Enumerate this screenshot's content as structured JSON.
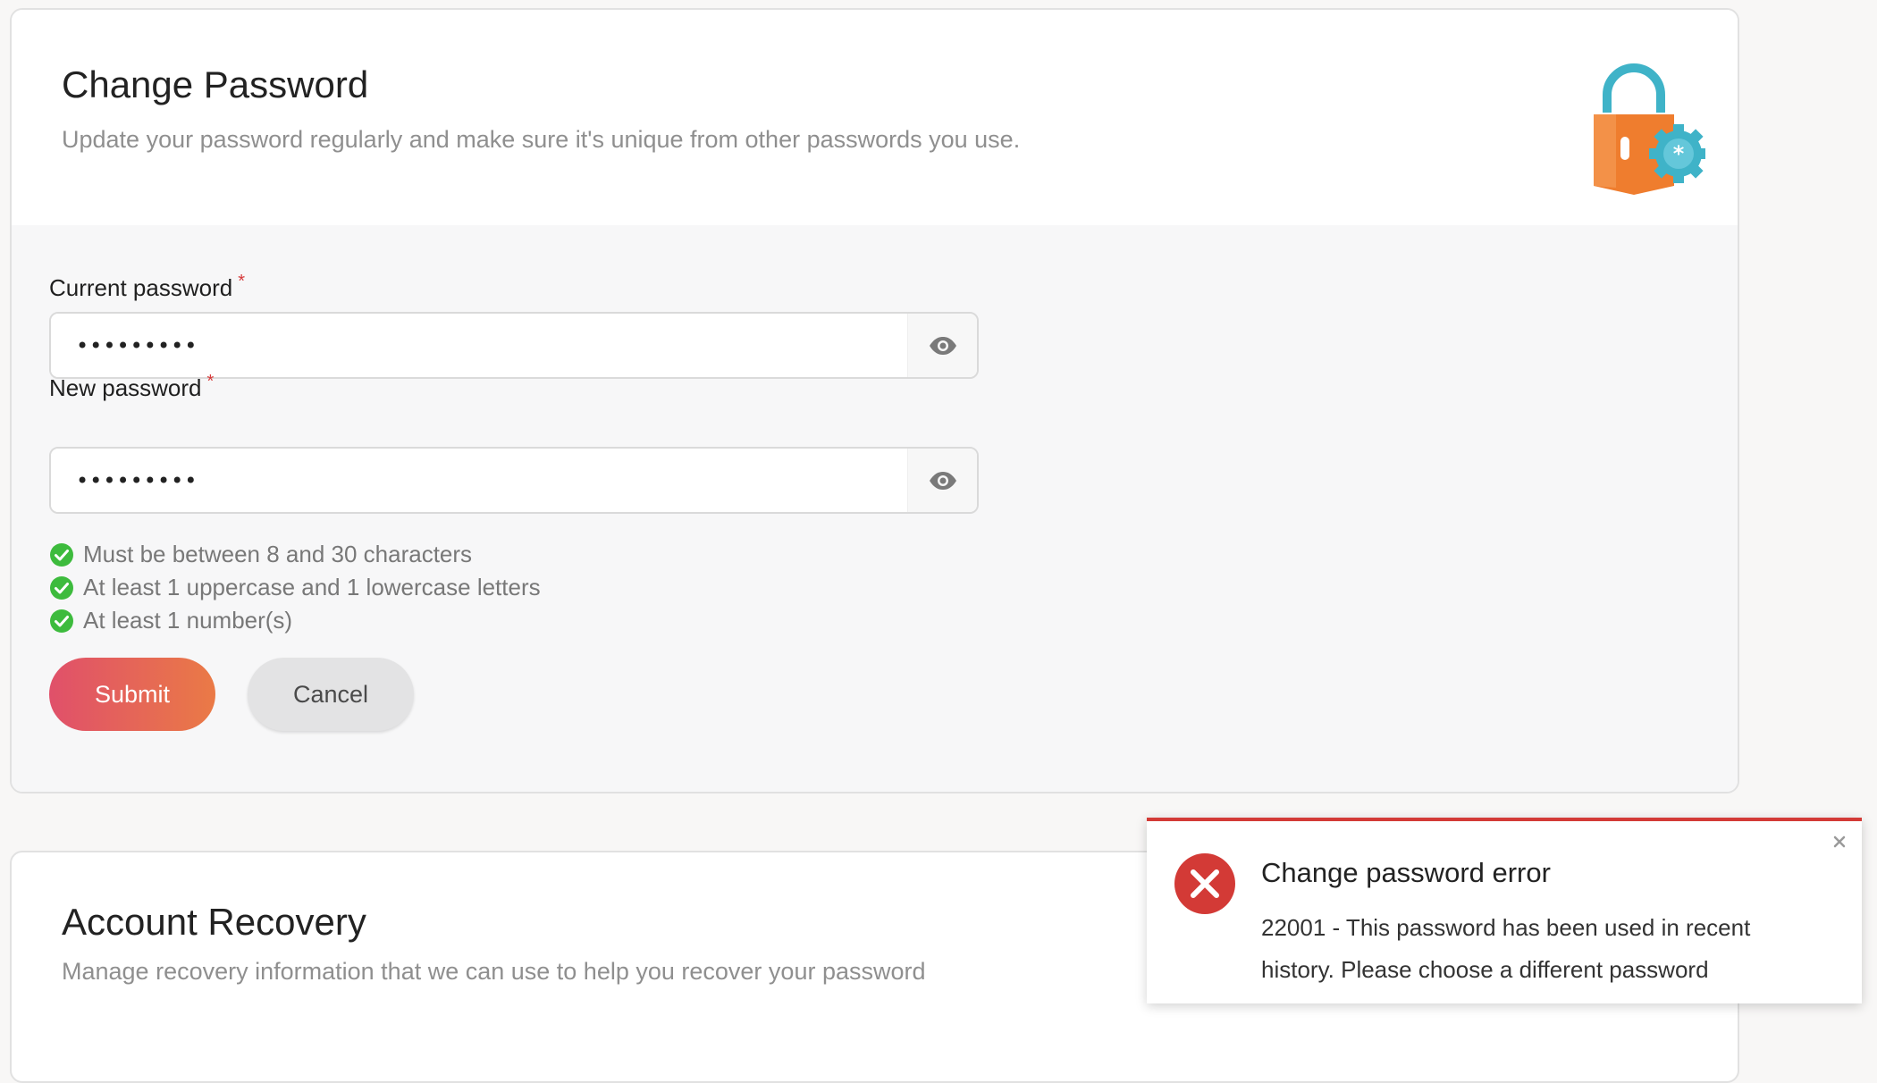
{
  "change_password": {
    "title": "Change Password",
    "description": "Update your password regularly and make sure it's unique from other passwords you use.",
    "current_password": {
      "label": "Current password",
      "required_mark": "*",
      "value": "•••••••••"
    },
    "new_password": {
      "label": "New password",
      "required_mark": "*",
      "value": "•••••••••"
    },
    "rules": [
      "Must be between 8 and 30 characters",
      "At least 1 uppercase and 1 lowercase letters",
      "At least 1 number(s)"
    ],
    "submit_label": "Submit",
    "cancel_label": "Cancel",
    "icons": {
      "illustration": "lock-gear-icon",
      "reveal": "eye-icon",
      "rule_status": "check-circle-icon"
    }
  },
  "account_recovery": {
    "title": "Account Recovery",
    "description": "Manage recovery information that we can use to help you recover your password"
  },
  "toast": {
    "title": "Change password error",
    "message": "22001 - This password has been used in recent history. Please choose a different password",
    "icon": "error-x-icon",
    "close_icon": "close-icon"
  },
  "colors": {
    "accent_start": "#e0506a",
    "accent_end": "#ea7a46",
    "error": "#d33a36",
    "success": "#3dbb3d",
    "lock_body": "#ef7d2e",
    "lock_shackle": "#3fb3c8"
  }
}
